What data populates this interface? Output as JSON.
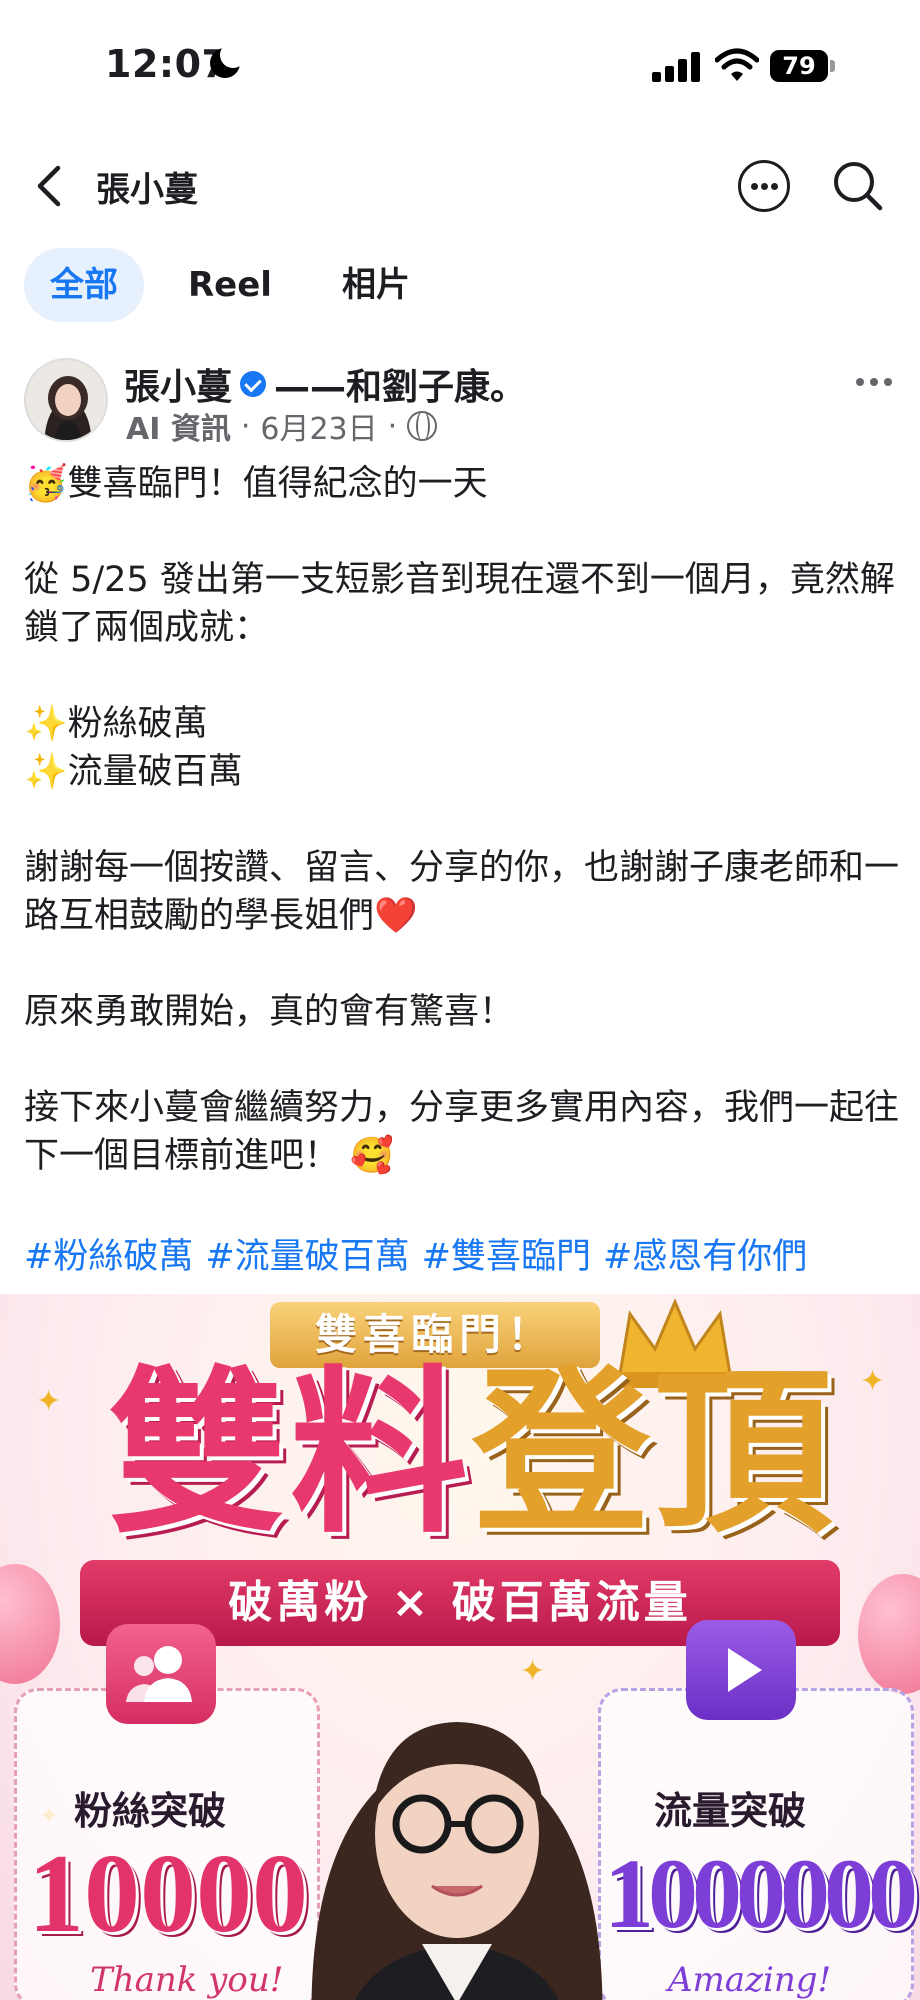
{
  "status_bar": {
    "time": "12:07",
    "battery": "79"
  },
  "header": {
    "title": "張小蔓"
  },
  "tabs": [
    {
      "label": "全部",
      "active": true
    },
    {
      "label": "Reel",
      "active": false
    },
    {
      "label": "相片",
      "active": false
    }
  ],
  "post": {
    "author": "張小蔓",
    "with_text": "——和劉子康。",
    "source": "AI 資訊",
    "date": "6月23日",
    "separator": "·",
    "body": "🥳雙喜臨門！值得紀念的一天\n\n從 5/25 發出第一支短影音到現在還不到一個月，竟然解鎖了兩個成就：\n\n✨粉絲破萬\n✨流量破百萬\n\n謝謝每一個按讚、留言、分享的你，也謝謝子康老師和一路互相鼓勵的學長姐們❤️\n\n原來勇敢開始，真的會有驚喜！\n\n接下來小蔓會繼續努力，分享更多實用內容，我們一起往下一個目標前進吧！ 🥰",
    "hashtags": [
      "#粉絲破萬",
      "#流量破百萬",
      "#雙喜臨門",
      "#感恩有你們"
    ]
  },
  "poster": {
    "banner": "雙喜臨門！",
    "headline": [
      "雙",
      "料",
      "登",
      "頂"
    ],
    "ribbon": "破萬粉 × 破百萬流量",
    "left_label": "粉絲突破",
    "left_number": "10000",
    "left_script": "Thank you!",
    "right_label": "流量突破",
    "right_number": "1000000",
    "right_script": "Amazing!"
  },
  "colors": {
    "accent": "#1877f2",
    "tab_active_bg": "#e7f0fd",
    "meta_gray": "#65676b",
    "poster_pink": "#e8386d",
    "poster_gold": "#e3a02b",
    "poster_purple": "#7d3ed8"
  },
  "icons": [
    "back-arrow-icon",
    "more-options-icon",
    "search-icon",
    "verified-badge-icon",
    "globe-icon",
    "post-more-icon"
  ]
}
